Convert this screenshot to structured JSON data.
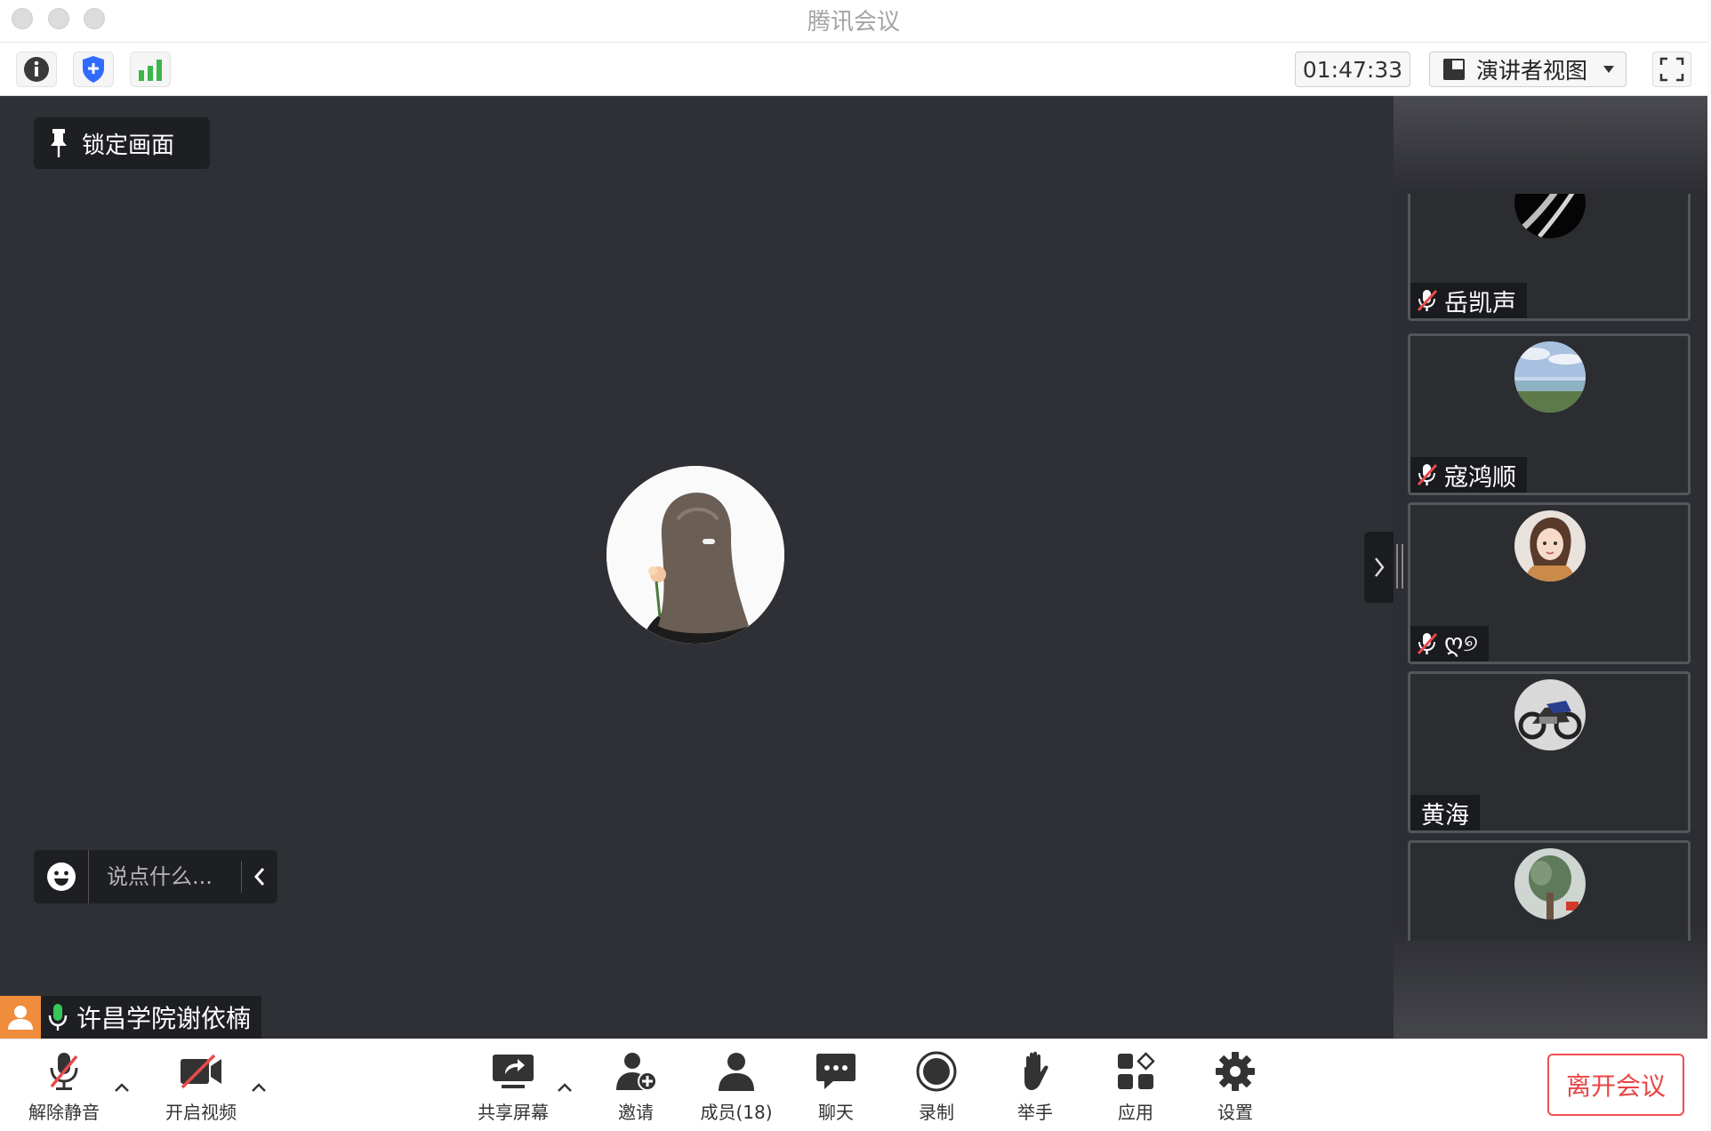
{
  "window": {
    "title": "腾讯会议"
  },
  "toolbar": {
    "timer": "01:47:33",
    "view_mode": "演讲者视图"
  },
  "main": {
    "lock_label": "锁定画面",
    "chat_placeholder": "说点什么...",
    "speaker_name": "许昌学院谢依楠"
  },
  "participants": [
    {
      "name": "岳凯声",
      "muted": true
    },
    {
      "name": "寇鸿顺",
      "muted": true
    },
    {
      "name": "ღ୭",
      "muted": true
    },
    {
      "name": "黄海",
      "muted": false
    },
    {
      "name": "",
      "muted": false
    }
  ],
  "bottombar": {
    "unmute": "解除静音",
    "start_video": "开启视频",
    "share_screen": "共享屏幕",
    "invite": "邀请",
    "members": "成员(18)",
    "chat": "聊天",
    "record": "录制",
    "raise_hand": "举手",
    "apps": "应用",
    "settings": "设置",
    "leave": "离开会议"
  },
  "colors": {
    "main_bg": "#2f3035",
    "speaker_accent": "#f08d3c",
    "leave_red": "#e94545",
    "mic_green": "#35c759",
    "shield_blue": "#2f6bff",
    "signal_green": "#3cb54a"
  }
}
